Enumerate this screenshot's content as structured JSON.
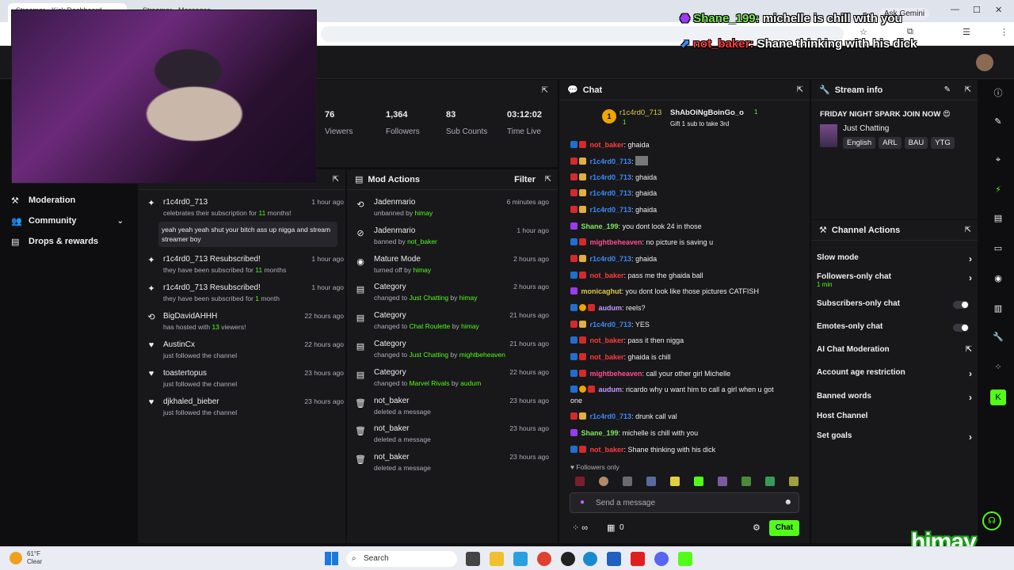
{
  "browser": {
    "tabs": [
      "Streamer - Kick Dashboard",
      "Streamer - Messages"
    ],
    "gemini_label": "Ask Gemini"
  },
  "overlay": [
    {
      "user": "Shane_199:",
      "msg": "michelle is chill with you"
    },
    {
      "user": "not_baker:",
      "msg": "Shane thinking with his dick"
    }
  ],
  "nav": {
    "items": [
      {
        "icon": "hammer-icon",
        "label": "Moderation"
      },
      {
        "icon": "users-icon",
        "label": "Community"
      },
      {
        "icon": "gift-icon",
        "label": "Drops & rewards"
      }
    ]
  },
  "stats": [
    {
      "value": "76",
      "label": "Viewers"
    },
    {
      "value": "1,364",
      "label": "Followers"
    },
    {
      "value": "83",
      "label": "Sub Counts"
    },
    {
      "value": "03:12:02",
      "label": "Time Live"
    }
  ],
  "activity": {
    "items": [
      {
        "title": "r1c4rd0_713",
        "sub_pre": "celebrates their subscription for ",
        "sub_hl": "11",
        "sub_post": " months!",
        "time": "1 hour ago",
        "quote": "yeah yeah yeah shut your bitch ass up nigga and stream streamer boy"
      },
      {
        "title": "r1c4rd0_713 Resubscribed!",
        "sub_pre": "they have been subscribed for ",
        "sub_hl": "11",
        "sub_post": " months",
        "time": "1 hour ago"
      },
      {
        "title": "r1c4rd0_713 Resubscribed!",
        "sub_pre": "they have been subscribed for ",
        "sub_hl": "1",
        "sub_post": " month",
        "time": "1 hour ago"
      },
      {
        "title": "BigDavidAHHH",
        "sub_pre": "has hosted with ",
        "sub_hl": "13",
        "sub_post": " viewers!",
        "time": "22 hours ago"
      },
      {
        "title": "AustinCx",
        "sub_pre": "just followed the channel",
        "sub_hl": "",
        "sub_post": "",
        "time": "22 hours ago"
      },
      {
        "title": "toastertopus",
        "sub_pre": "just followed the channel",
        "sub_hl": "",
        "sub_post": "",
        "time": "23 hours ago"
      },
      {
        "title": "djkhaled_bieber",
        "sub_pre": "just followed the channel",
        "sub_hl": "",
        "sub_post": "",
        "time": "23 hours ago"
      }
    ]
  },
  "mod_actions": {
    "title": "Mod Actions",
    "filter_label": "Filter",
    "items": [
      {
        "title": "Jadenmario",
        "pre": "unbanned by ",
        "hl": "himay",
        "mid": "",
        "hl2": "",
        "time": "6 minutes ago"
      },
      {
        "title": "Jadenmario",
        "pre": "banned by ",
        "hl": "not_baker",
        "mid": "",
        "hl2": "",
        "time": "1 hour ago"
      },
      {
        "title": "Mature Mode",
        "pre": "turned off by ",
        "hl": "himay",
        "mid": "",
        "hl2": "",
        "time": "2 hours ago"
      },
      {
        "title": "Category",
        "pre": "changed to ",
        "hl": "Just Chatting",
        "mid": " by ",
        "hl2": "himay",
        "time": "2 hours ago"
      },
      {
        "title": "Category",
        "pre": "changed to ",
        "hl": "Chat Roulette",
        "mid": " by ",
        "hl2": "himay",
        "time": "21 hours ago"
      },
      {
        "title": "Category",
        "pre": "changed to ",
        "hl": "Just Chatting",
        "mid": " by ",
        "hl2": "mightbeheaven",
        "time": "21 hours ago"
      },
      {
        "title": "Category",
        "pre": "changed to ",
        "hl": "Marvel Rivals",
        "mid": " by ",
        "hl2": "audum",
        "time": "22 hours ago"
      },
      {
        "title": "not_baker",
        "pre": "deleted a message",
        "hl": "",
        "mid": "",
        "hl2": "",
        "time": "23 hours ago"
      },
      {
        "title": "not_baker",
        "pre": "deleted a message",
        "hl": "",
        "mid": "",
        "hl2": "",
        "time": "23 hours ago"
      },
      {
        "title": "not_baker",
        "pre": "deleted a message",
        "hl": "",
        "mid": "",
        "hl2": "",
        "time": "23 hours ago"
      }
    ]
  },
  "chat": {
    "title": "Chat",
    "pinned": {
      "user1": "r1c4rd0_713",
      "count1": "1",
      "user2": "ShAbOiNgBoinGo_o",
      "count2": "1",
      "gift_text": "Gift 1 sub to take 3rd"
    },
    "messages": [
      {
        "user": "not_baker",
        "color": "c-red",
        "badges": [
          "b-kick",
          "b-red"
        ],
        "text": "ghaida"
      },
      {
        "user": "r1c4rd0_713",
        "color": "c-blue",
        "badges": [
          "b-red",
          "b-gift"
        ],
        "text": ""
      },
      {
        "user": "r1c4rd0_713",
        "color": "c-blue",
        "badges": [
          "b-red",
          "b-gift"
        ],
        "text": "ghaida"
      },
      {
        "user": "r1c4rd0_713",
        "color": "c-blue",
        "badges": [
          "b-red",
          "b-gift"
        ],
        "text": "ghaida"
      },
      {
        "user": "r1c4rd0_713",
        "color": "c-blue",
        "badges": [
          "b-red",
          "b-gift"
        ],
        "text": "ghaida"
      },
      {
        "user": "Shane_199",
        "color": "c-green",
        "badges": [
          "b-purp"
        ],
        "text": "you dont look 24 in those"
      },
      {
        "user": "mightbeheaven",
        "color": "c-pink",
        "badges": [
          "b-kick",
          "b-red"
        ],
        "text": "no picture is saving u"
      },
      {
        "user": "r1c4rd0_713",
        "color": "c-blue",
        "badges": [
          "b-red",
          "b-gift"
        ],
        "text": "ghaida"
      },
      {
        "user": "not_baker",
        "color": "c-red",
        "badges": [
          "b-kick",
          "b-red"
        ],
        "text": "pass me the ghaida ball"
      },
      {
        "user": "monicaghut",
        "color": "c-yel",
        "badges": [
          "b-purp"
        ],
        "text": "you dont look like those pictures CATFISH"
      },
      {
        "user": "audum",
        "color": "c-lav",
        "badges": [
          "b-kick",
          "b-gold",
          "b-red"
        ],
        "text": "reels?"
      },
      {
        "user": "r1c4rd0_713",
        "color": "c-blue",
        "badges": [
          "b-red",
          "b-gift"
        ],
        "text": "YES"
      },
      {
        "user": "not_baker",
        "color": "c-red",
        "badges": [
          "b-kick",
          "b-red"
        ],
        "text": "pass it then nigga"
      },
      {
        "user": "not_baker",
        "color": "c-red",
        "badges": [
          "b-kick",
          "b-red"
        ],
        "text": "ghaida is chill"
      },
      {
        "user": "mightbeheaven",
        "color": "c-pink",
        "badges": [
          "b-kick",
          "b-red"
        ],
        "text": "call your other girl Michelle"
      },
      {
        "user": "audum",
        "color": "c-lav",
        "badges": [
          "b-kick",
          "b-gold",
          "b-red"
        ],
        "text": "ricardo why u want him to call a girl when u got"
      },
      {
        "user": "",
        "color": "",
        "badges": [],
        "text": "one"
      },
      {
        "user": "r1c4rd0_713",
        "color": "c-blue",
        "badges": [
          "b-red",
          "b-gift"
        ],
        "text": "drunk call val"
      },
      {
        "user": "Shane_199",
        "color": "c-green",
        "badges": [
          "b-purp"
        ],
        "text": "michelle is chill with you"
      },
      {
        "user": "not_baker",
        "color": "c-red",
        "badges": [
          "b-kick",
          "b-red"
        ],
        "text": "Shane thinking with his dick"
      }
    ],
    "followers_only": "Followers only",
    "placeholder": "Send a message",
    "points": "0",
    "send_label": "Chat"
  },
  "stream_info": {
    "title": "Stream info",
    "stream_title": "FRIDAY NIGHT SPARK JOIN NOW",
    "category": "Just Chatting",
    "tags": [
      "English",
      "ARL",
      "BAU",
      "YTG"
    ]
  },
  "channel_actions": {
    "title": "Channel Actions",
    "items": [
      {
        "label": "Slow mode",
        "sub": "",
        "ctrl": "chev"
      },
      {
        "label": "Followers-only chat",
        "sub": "1 min",
        "ctrl": "chev"
      },
      {
        "label": "Subscribers-only chat",
        "sub": "",
        "ctrl": "toggle"
      },
      {
        "label": "Emotes-only chat",
        "sub": "",
        "ctrl": "toggle"
      },
      {
        "label": "AI Chat Moderation",
        "sub": "",
        "ctrl": "ext"
      },
      {
        "label": "Account age restriction",
        "sub": "",
        "ctrl": "chev"
      },
      {
        "label": "Banned words",
        "sub": "",
        "ctrl": "chev"
      },
      {
        "label": "Host Channel",
        "sub": "",
        "ctrl": "none"
      },
      {
        "label": "Set goals",
        "sub": "",
        "ctrl": "chev"
      }
    ]
  },
  "taskbar": {
    "temp": "61°F",
    "weather": "Clear",
    "search": "Search"
  },
  "logo_text": "himay",
  "colors": {
    "accent": "#53fc18",
    "panel": "#18181b",
    "bg": "#0e0e10"
  }
}
